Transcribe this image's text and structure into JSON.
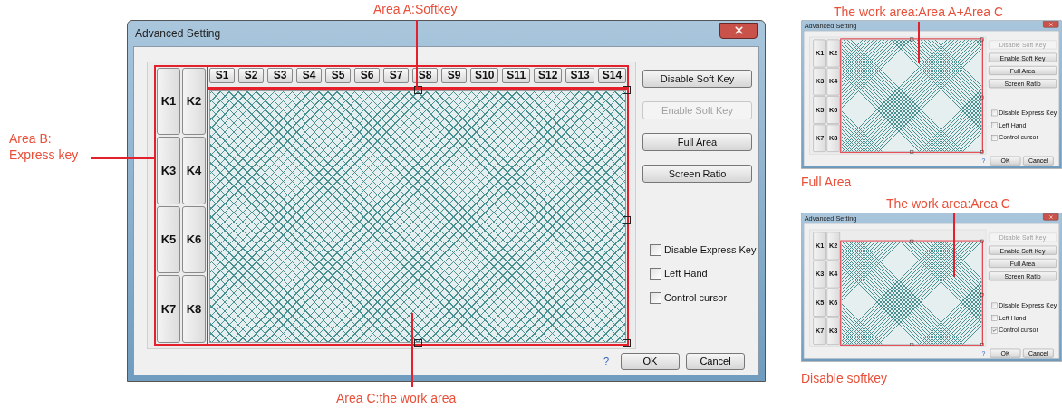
{
  "main_figure": {
    "label_top": "Area A:Softkey",
    "label_left": [
      "Area B:",
      "Express key"
    ],
    "label_bottom": "Area C:the work area",
    "dialog": {
      "title": "Advanced Setting",
      "work_area_full": false,
      "highlight_express_keys": true,
      "highlight_softkeys": true,
      "highlight_work_area": true,
      "softkeys": [
        "S1",
        "S2",
        "S3",
        "S4",
        "S5",
        "S6",
        "S7",
        "S8",
        "S9",
        "S10",
        "S11",
        "S12",
        "S13",
        "S14"
      ],
      "express_keys": [
        "K1",
        "K2",
        "K3",
        "K4",
        "K5",
        "K6",
        "K7",
        "K8"
      ],
      "buttons": [
        {
          "label": "Disable Soft Key",
          "disabled": false
        },
        {
          "label": "Enable Soft Key",
          "disabled": true
        },
        {
          "label": "Full Area",
          "disabled": false
        },
        {
          "label": "Screen Ratio",
          "disabled": false
        }
      ],
      "checkboxes": [
        {
          "label": "Disable Express Key",
          "checked": false
        },
        {
          "label": "Left Hand",
          "checked": false
        },
        {
          "label": "Control cursor",
          "checked": false
        }
      ],
      "help": "?",
      "ok": "OK",
      "cancel": "Cancel"
    }
  },
  "thumbnails": [
    {
      "label_top": "The work area:Area A+Area C",
      "caption": "Full Area",
      "dialog": {
        "title": "Advanced Setting",
        "work_area_full": true,
        "highlight_work_area": true,
        "express_keys": [
          "K1",
          "K2",
          "K3",
          "K4",
          "K5",
          "K6",
          "K7",
          "K8"
        ],
        "buttons": [
          {
            "label": "Disable Soft Key",
            "disabled": true
          },
          {
            "label": "Enable Soft Key",
            "disabled": false
          },
          {
            "label": "Full Area",
            "disabled": false
          },
          {
            "label": "Screen Ratio",
            "disabled": false
          }
        ],
        "checkboxes": [
          {
            "label": "Disable Express Key",
            "checked": false
          },
          {
            "label": "Left Hand",
            "checked": false
          },
          {
            "label": "Control cursor",
            "checked": false
          }
        ],
        "help": "?",
        "ok": "OK",
        "cancel": "Cancel"
      }
    },
    {
      "label_top": "The work area:Area C",
      "caption": "Disable softkey",
      "dialog": {
        "title": "Advanced Setting",
        "work_area_full": false,
        "highlight_work_area": true,
        "express_keys": [
          "K1",
          "K2",
          "K3",
          "K4",
          "K5",
          "K6",
          "K7",
          "K8"
        ],
        "buttons": [
          {
            "label": "Disable Soft Key",
            "disabled": true
          },
          {
            "label": "Enable Soft Key",
            "disabled": false
          },
          {
            "label": "Full Area",
            "disabled": false
          },
          {
            "label": "Screen Ratio",
            "disabled": false
          }
        ],
        "checkboxes": [
          {
            "label": "Disable Express Key",
            "checked": false
          },
          {
            "label": "Left Hand",
            "checked": false
          },
          {
            "label": "Control cursor",
            "checked": true
          }
        ],
        "help": "?",
        "ok": "OK",
        "cancel": "Cancel"
      }
    }
  ]
}
